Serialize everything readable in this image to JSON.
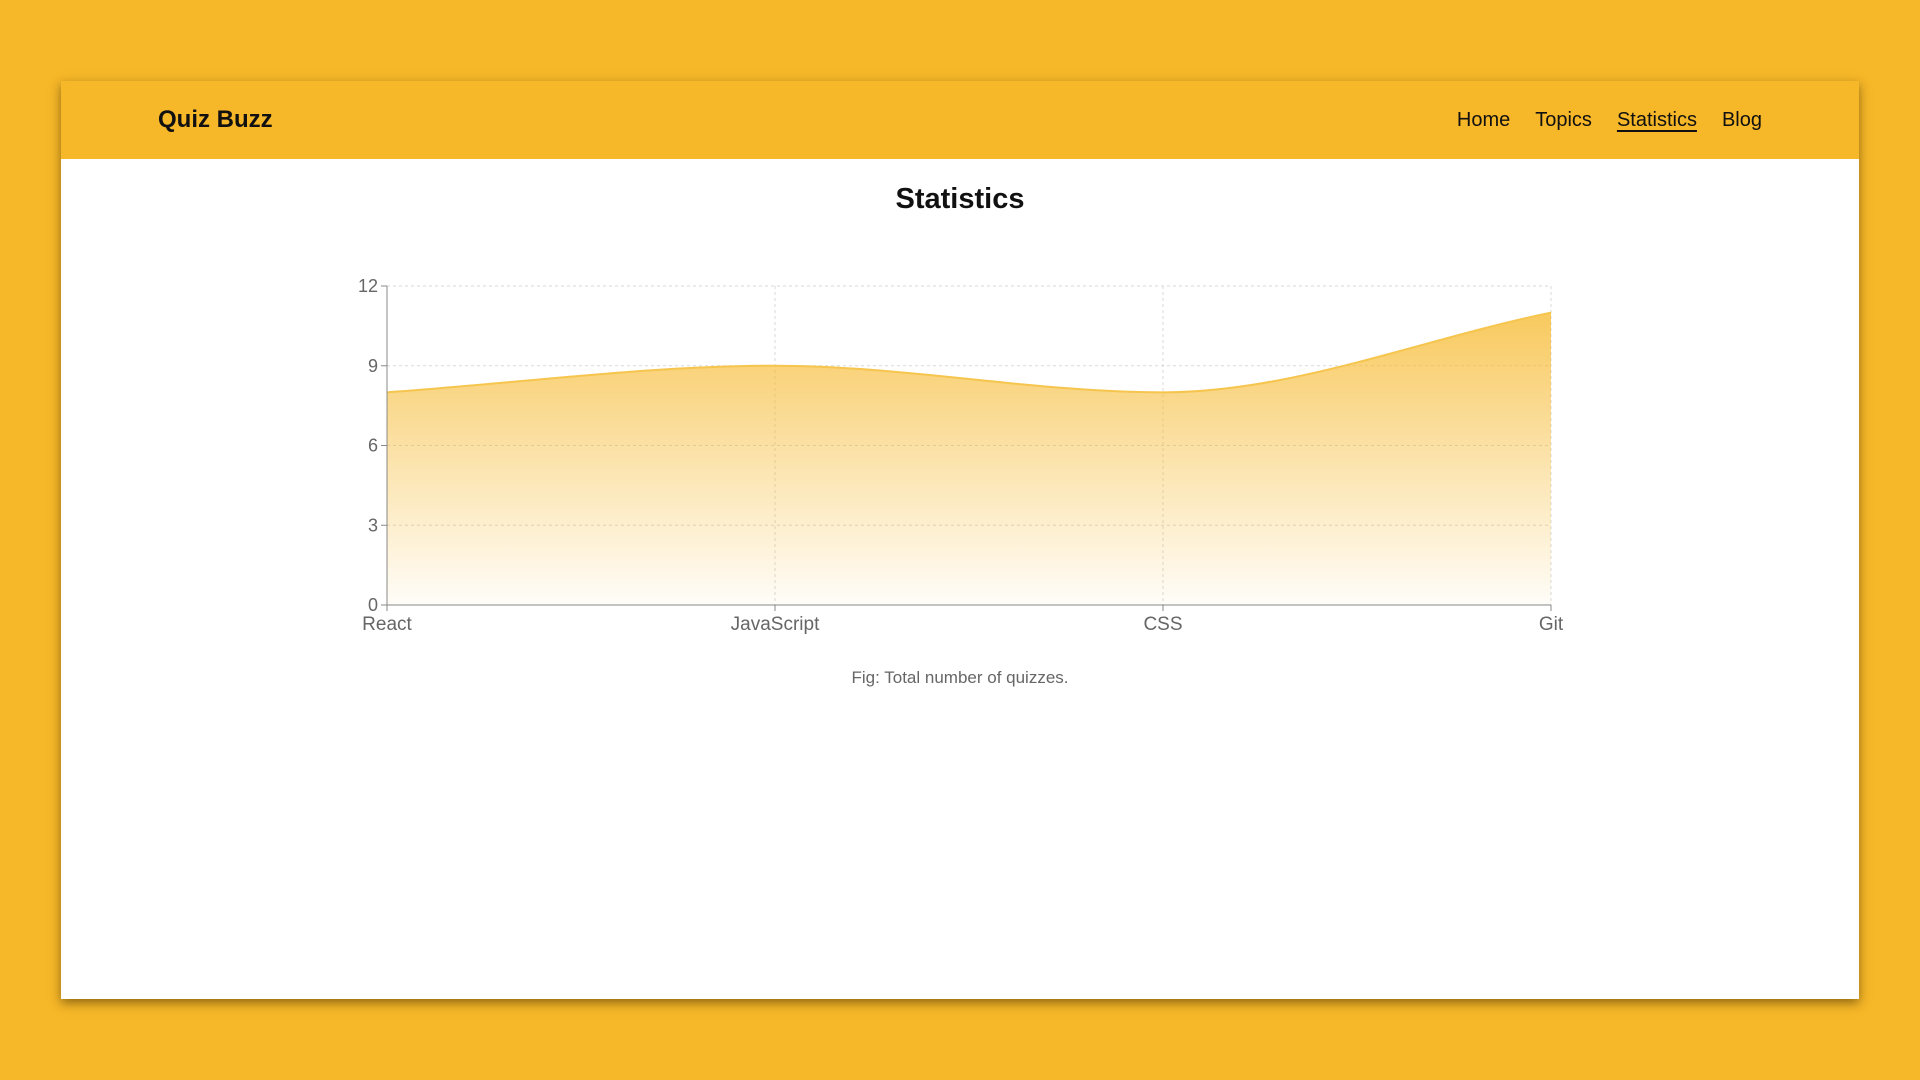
{
  "header": {
    "brand": "Quiz Buzz",
    "nav": [
      {
        "label": "Home",
        "active": false
      },
      {
        "label": "Topics",
        "active": false
      },
      {
        "label": "Statistics",
        "active": true
      },
      {
        "label": "Blog",
        "active": false
      }
    ]
  },
  "main": {
    "title": "Statistics",
    "caption": "Fig: Total number of quizzes."
  },
  "colors": {
    "background": "#F6B728",
    "area_stroke": "#F6C54E",
    "area_fill": "#F6B728"
  },
  "chart_data": {
    "type": "area",
    "categories": [
      "React",
      "JavaScript",
      "CSS",
      "Git"
    ],
    "series": [
      {
        "values": [
          8,
          9,
          8,
          11
        ]
      }
    ],
    "yticks": [
      0,
      3,
      6,
      9,
      12
    ],
    "ylim": [
      0,
      12
    ],
    "grid": true,
    "curve": "smooth"
  }
}
